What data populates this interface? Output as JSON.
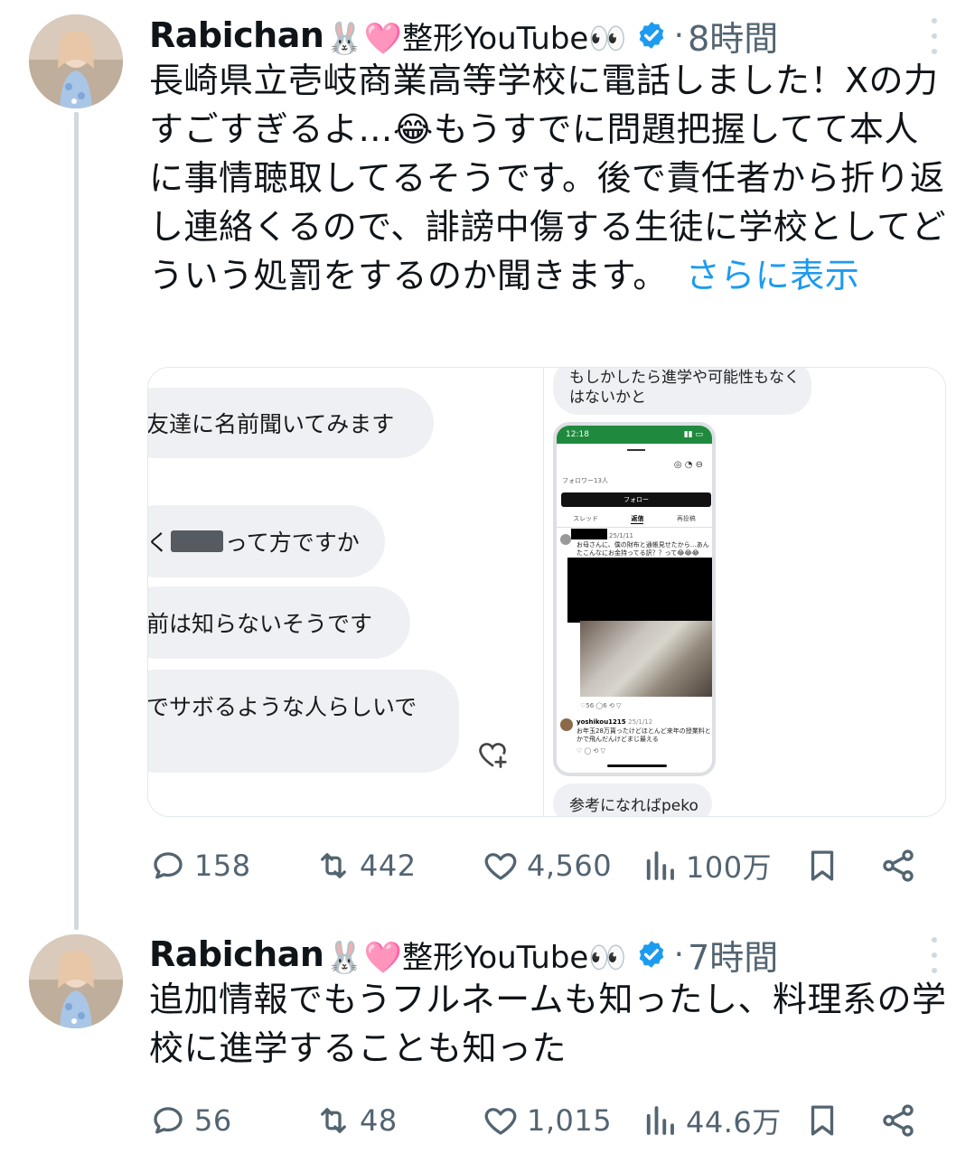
{
  "tweets": [
    {
      "author": "Rabichan",
      "author_emoji": "🐰🩷整形YouTube👀",
      "time": "8時間",
      "text": "長崎県立壱岐商業高等学校に電話しました！Xの力すごすぎるよ…😂もうすでに問題把握してて本人に事情聴取してるそうです。後で責任者から折り返し連絡くるので、誹謗中傷する生徒に学校としてどういう処罰をするのか聞きます。",
      "show_more": "さらに表示",
      "stats": {
        "replies": "158",
        "retweets": "442",
        "likes": "4,560",
        "views": "100万"
      }
    },
    {
      "author": "Rabichan",
      "author_emoji": "🐰🩷整形YouTube👀",
      "time": "7時間",
      "text": "追加情報でもうフルネームも知ったし、料理系の学校に進学することも知った",
      "stats": {
        "replies": "56",
        "retweets": "48",
        "likes": "1,015",
        "views": "44.6万"
      }
    }
  ],
  "media": {
    "left_chat": [
      "友達に名前聞いてみます",
      "く",
      "って方ですか",
      "前は知らないそうです",
      "でサボるような人らしいで"
    ],
    "right_chat_top": [
      "もしかしたら進学や可能性もなく",
      "はないかと"
    ],
    "right_chat_bottom": "参考になればpeko",
    "phone": {
      "time": "12:18",
      "followers": "フォロワー13人",
      "follow_button": "フォロー",
      "tabs": [
        "スレッド",
        "返信",
        "再投稿"
      ],
      "post1_date": "25/1/11",
      "post1_text": "お母さんに、僕の財布と通帳見せたから…あんたこんなにお金持ってる訳？？って😂😂😂",
      "post1_stats": [
        "56",
        "6"
      ],
      "post2_user": "yoshikou1215",
      "post2_date": "25/1/12",
      "post2_text": "お年玉28万貰ったけどほとんど来年の授業料とかで飛んだんけどまじ最える"
    }
  }
}
